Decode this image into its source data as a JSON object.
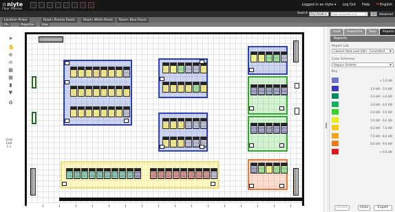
{
  "app": {
    "name": "nlyte",
    "title": "Floor Planner"
  },
  "toplinks": [
    "Logged in as nlyte ▾",
    "Log Out",
    "Help",
    "English"
  ],
  "search": {
    "label": "Search",
    "type_value": "Any Asset ▾",
    "placeholder": "Enter Name/Bar Kod",
    "clear": "×",
    "go": "GO",
    "advanced": "Advanced"
  },
  "crumbs": [
    "Location Picker",
    "Room: Bronze Room",
    "Room: White Room",
    "Room: Blue Room"
  ],
  "subtabs": [
    "File",
    "Properties",
    "View"
  ],
  "grid": {
    "label": "Grid Cell",
    "value": "(--)"
  },
  "icons": [
    "pointer-icon",
    "hand-icon",
    "zoom-in-icon",
    "zoom-out-icon",
    "fit-icon",
    "rack-icon",
    "cabinet-icon",
    "filter-icon",
    "refresh-icon"
  ],
  "right_panel": {
    "tabs": [
      "Inset",
      "Properties",
      "Tools",
      "Reports"
    ],
    "active_tab": "Reports",
    "header": "Reports",
    "report_label": "Report Lab",
    "report_value": "Cabinet Heat Load (kW) - Committed",
    "scheme_label": "Color Schemes",
    "scheme_value": "Regular Scheme",
    "key_label": "Key",
    "key": [
      {
        "label": "< 1.0 kW",
        "color": "#6f73c8"
      },
      {
        "label": "1.0 kW - 2.0 kW",
        "color": "#3a39b8"
      },
      {
        "label": "2.0 kW - 3.0 kW",
        "color": "#0b8a5c"
      },
      {
        "label": "3.0 kW - 4.0 kW",
        "color": "#11b061"
      },
      {
        "label": "4.0 kW - 5.0 kW",
        "color": "#39d228"
      },
      {
        "label": "5.0 kW - 6.0 kW",
        "color": "#e8ec19"
      },
      {
        "label": "6.0 kW - 7.0 kW",
        "color": "#f3cc18"
      },
      {
        "label": "7.0 kW - 8.0 kW",
        "color": "#f3a51d"
      },
      {
        "label": "8.0 kW - 9.0 kW",
        "color": "#ef7a1b"
      },
      {
        "label": "> 9.0 kW",
        "color": "#e11b1b"
      }
    ],
    "buttons": [
      "Update",
      "Close",
      "Export"
    ]
  }
}
